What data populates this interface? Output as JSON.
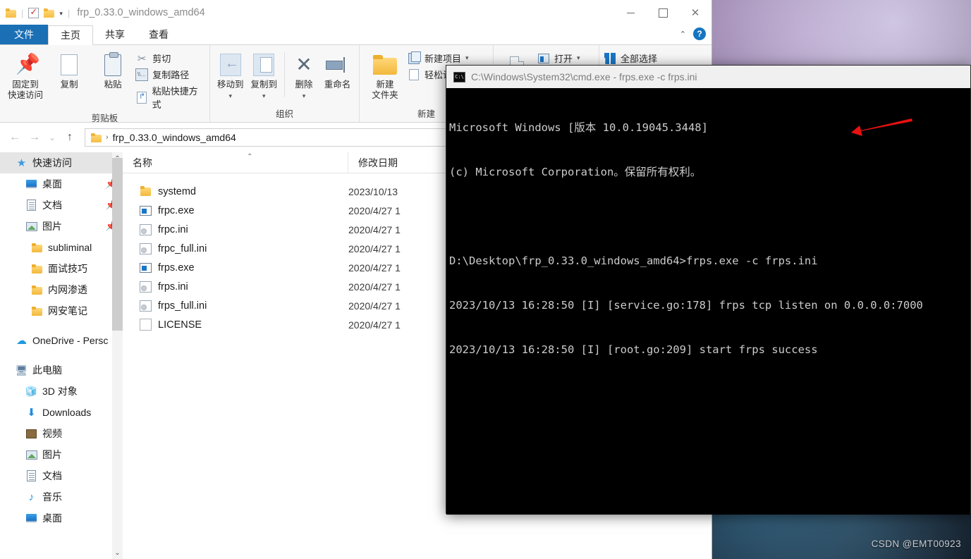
{
  "desktop": {
    "watermark": "CSDN @EMT00923"
  },
  "explorer": {
    "titlebar": {
      "title": "frp_0.33.0_windows_amd64",
      "qat_icons": [
        "folder-icon",
        "properties-check-icon",
        "new-folder-icon",
        "customize-caret-icon"
      ],
      "minimize": "—",
      "maximize": "□",
      "close": "✕"
    },
    "tabs": [
      {
        "label": "文件",
        "name": "tab-file"
      },
      {
        "label": "主页",
        "name": "tab-home"
      },
      {
        "label": "共享",
        "name": "tab-share"
      },
      {
        "label": "查看",
        "name": "tab-view"
      }
    ],
    "ribbon_right": {
      "collapse": "⌃",
      "help": "?"
    },
    "ribbon": {
      "groups": [
        {
          "name": "clipboard",
          "label": "剪贴板",
          "big_buttons": [
            {
              "label": "固定到\n快速访问",
              "icon": "pin-icon"
            },
            {
              "label": "复制",
              "icon": "copy-icon"
            },
            {
              "label": "粘贴",
              "icon": "paste-icon"
            }
          ],
          "small_buttons": [
            {
              "label": "剪切",
              "icon": "scissors-icon"
            },
            {
              "label": "复制路径",
              "icon": "copy-path-icon"
            },
            {
              "label": "粘贴快捷方式",
              "icon": "paste-shortcut-icon"
            }
          ]
        },
        {
          "name": "organize",
          "label": "组织",
          "big_buttons": [
            {
              "label": "移动到",
              "icon": "move-to-icon"
            },
            {
              "label": "复制到",
              "icon": "copy-to-icon"
            },
            {
              "label": "删除",
              "icon": "delete-icon"
            },
            {
              "label": "重命名",
              "icon": "rename-icon"
            }
          ],
          "small_buttons": []
        },
        {
          "name": "new",
          "label": "新建",
          "big_buttons": [
            {
              "label": "新建\n文件夹",
              "icon": "new-folder-icon"
            }
          ],
          "small_buttons": [
            {
              "label": "新建项目",
              "icon": "new-item-icon"
            },
            {
              "label": "轻松访问",
              "icon": "easy-access-icon"
            }
          ]
        },
        {
          "name": "open",
          "label": "",
          "big_buttons": [
            {
              "label": "",
              "icon": "properties-icon"
            }
          ],
          "small_buttons": [
            {
              "label": "打开",
              "icon": "open-icon"
            }
          ]
        },
        {
          "name": "select",
          "label": "",
          "big_buttons": [],
          "small_buttons": [
            {
              "label": "全部选择",
              "icon": "select-all-icon"
            }
          ]
        }
      ]
    },
    "address_bar": {
      "back": "←",
      "forward": "→",
      "recent": "⌄",
      "up": "↑",
      "breadcrumb_sep": "›",
      "path": "frp_0.33.0_windows_amd64"
    },
    "sidebar": {
      "items": [
        {
          "label": "快速访问",
          "icon": "star-pin-icon",
          "indent": 0,
          "header": true,
          "pinned": false
        },
        {
          "label": "桌面",
          "icon": "desktop-icon",
          "indent": 1,
          "header": false,
          "pinned": true
        },
        {
          "label": "文档",
          "icon": "documents-icon",
          "indent": 1,
          "header": false,
          "pinned": true
        },
        {
          "label": "图片",
          "icon": "pictures-icon",
          "indent": 1,
          "header": false,
          "pinned": true
        },
        {
          "label": "subliminal",
          "icon": "folder-icon",
          "indent": 2,
          "header": false,
          "pinned": false
        },
        {
          "label": "面试技巧",
          "icon": "folder-icon",
          "indent": 2,
          "header": false,
          "pinned": false
        },
        {
          "label": "内网渗透",
          "icon": "folder-icon",
          "indent": 2,
          "header": false,
          "pinned": false
        },
        {
          "label": "网安笔记",
          "icon": "folder-icon",
          "indent": 2,
          "header": false,
          "pinned": false
        },
        {
          "label": "OneDrive - Persc",
          "icon": "onedrive-icon",
          "indent": 0,
          "header": false,
          "pinned": false,
          "spacer_before": true
        },
        {
          "label": "此电脑",
          "icon": "this-pc-icon",
          "indent": 0,
          "header": false,
          "pinned": false,
          "spacer_before": true
        },
        {
          "label": "3D 对象",
          "icon": "3d-objects-icon",
          "indent": 1,
          "header": false,
          "pinned": false
        },
        {
          "label": "Downloads",
          "icon": "downloads-icon",
          "indent": 1,
          "header": false,
          "pinned": false
        },
        {
          "label": "视频",
          "icon": "videos-icon",
          "indent": 1,
          "header": false,
          "pinned": false
        },
        {
          "label": "图片",
          "icon": "pictures-icon",
          "indent": 1,
          "header": false,
          "pinned": false
        },
        {
          "label": "文档",
          "icon": "documents-icon",
          "indent": 1,
          "header": false,
          "pinned": false
        },
        {
          "label": "音乐",
          "icon": "music-icon",
          "indent": 1,
          "header": false,
          "pinned": false
        },
        {
          "label": "桌面",
          "icon": "desktop-icon",
          "indent": 1,
          "header": false,
          "pinned": false
        }
      ],
      "scroll_up": "⌃",
      "scroll_down": "⌄"
    },
    "filelist": {
      "columns": [
        {
          "label": "名称",
          "name": "column-name"
        },
        {
          "label": "修改日期",
          "name": "column-modified-date"
        }
      ],
      "sort_indicator": "⌃",
      "rows": [
        {
          "name": "systemd",
          "icon": "folder-icon",
          "date": "2023/10/13"
        },
        {
          "name": "frpc.exe",
          "icon": "exe-icon",
          "date": "2020/4/27 1"
        },
        {
          "name": "frpc.ini",
          "icon": "ini-icon",
          "date": "2020/4/27 1"
        },
        {
          "name": "frpc_full.ini",
          "icon": "ini-icon",
          "date": "2020/4/27 1"
        },
        {
          "name": "frps.exe",
          "icon": "exe-icon",
          "date": "2020/4/27 1"
        },
        {
          "name": "frps.ini",
          "icon": "ini-icon",
          "date": "2020/4/27 1"
        },
        {
          "name": "frps_full.ini",
          "icon": "ini-icon",
          "date": "2020/4/27 1"
        },
        {
          "name": "LICENSE",
          "icon": "file-icon",
          "date": "2020/4/27 1"
        }
      ]
    }
  },
  "cmd": {
    "title": "C:\\Windows\\System32\\cmd.exe - frps.exe  -c frps.ini",
    "lines": [
      "Microsoft Windows [版本 10.0.19045.3448]",
      "(c) Microsoft Corporation。保留所有权利。",
      "",
      "D:\\Desktop\\frp_0.33.0_windows_amd64>frps.exe -c frps.ini",
      "2023/10/13 16:28:50 [I] [service.go:178] frps tcp listen on 0.0.0.0:7000",
      "2023/10/13 16:28:50 [I] [root.go:209] start frps success"
    ]
  },
  "annotation": {
    "arrow_color": "#e81010",
    "arrow_name": "red-pointer-arrow"
  }
}
